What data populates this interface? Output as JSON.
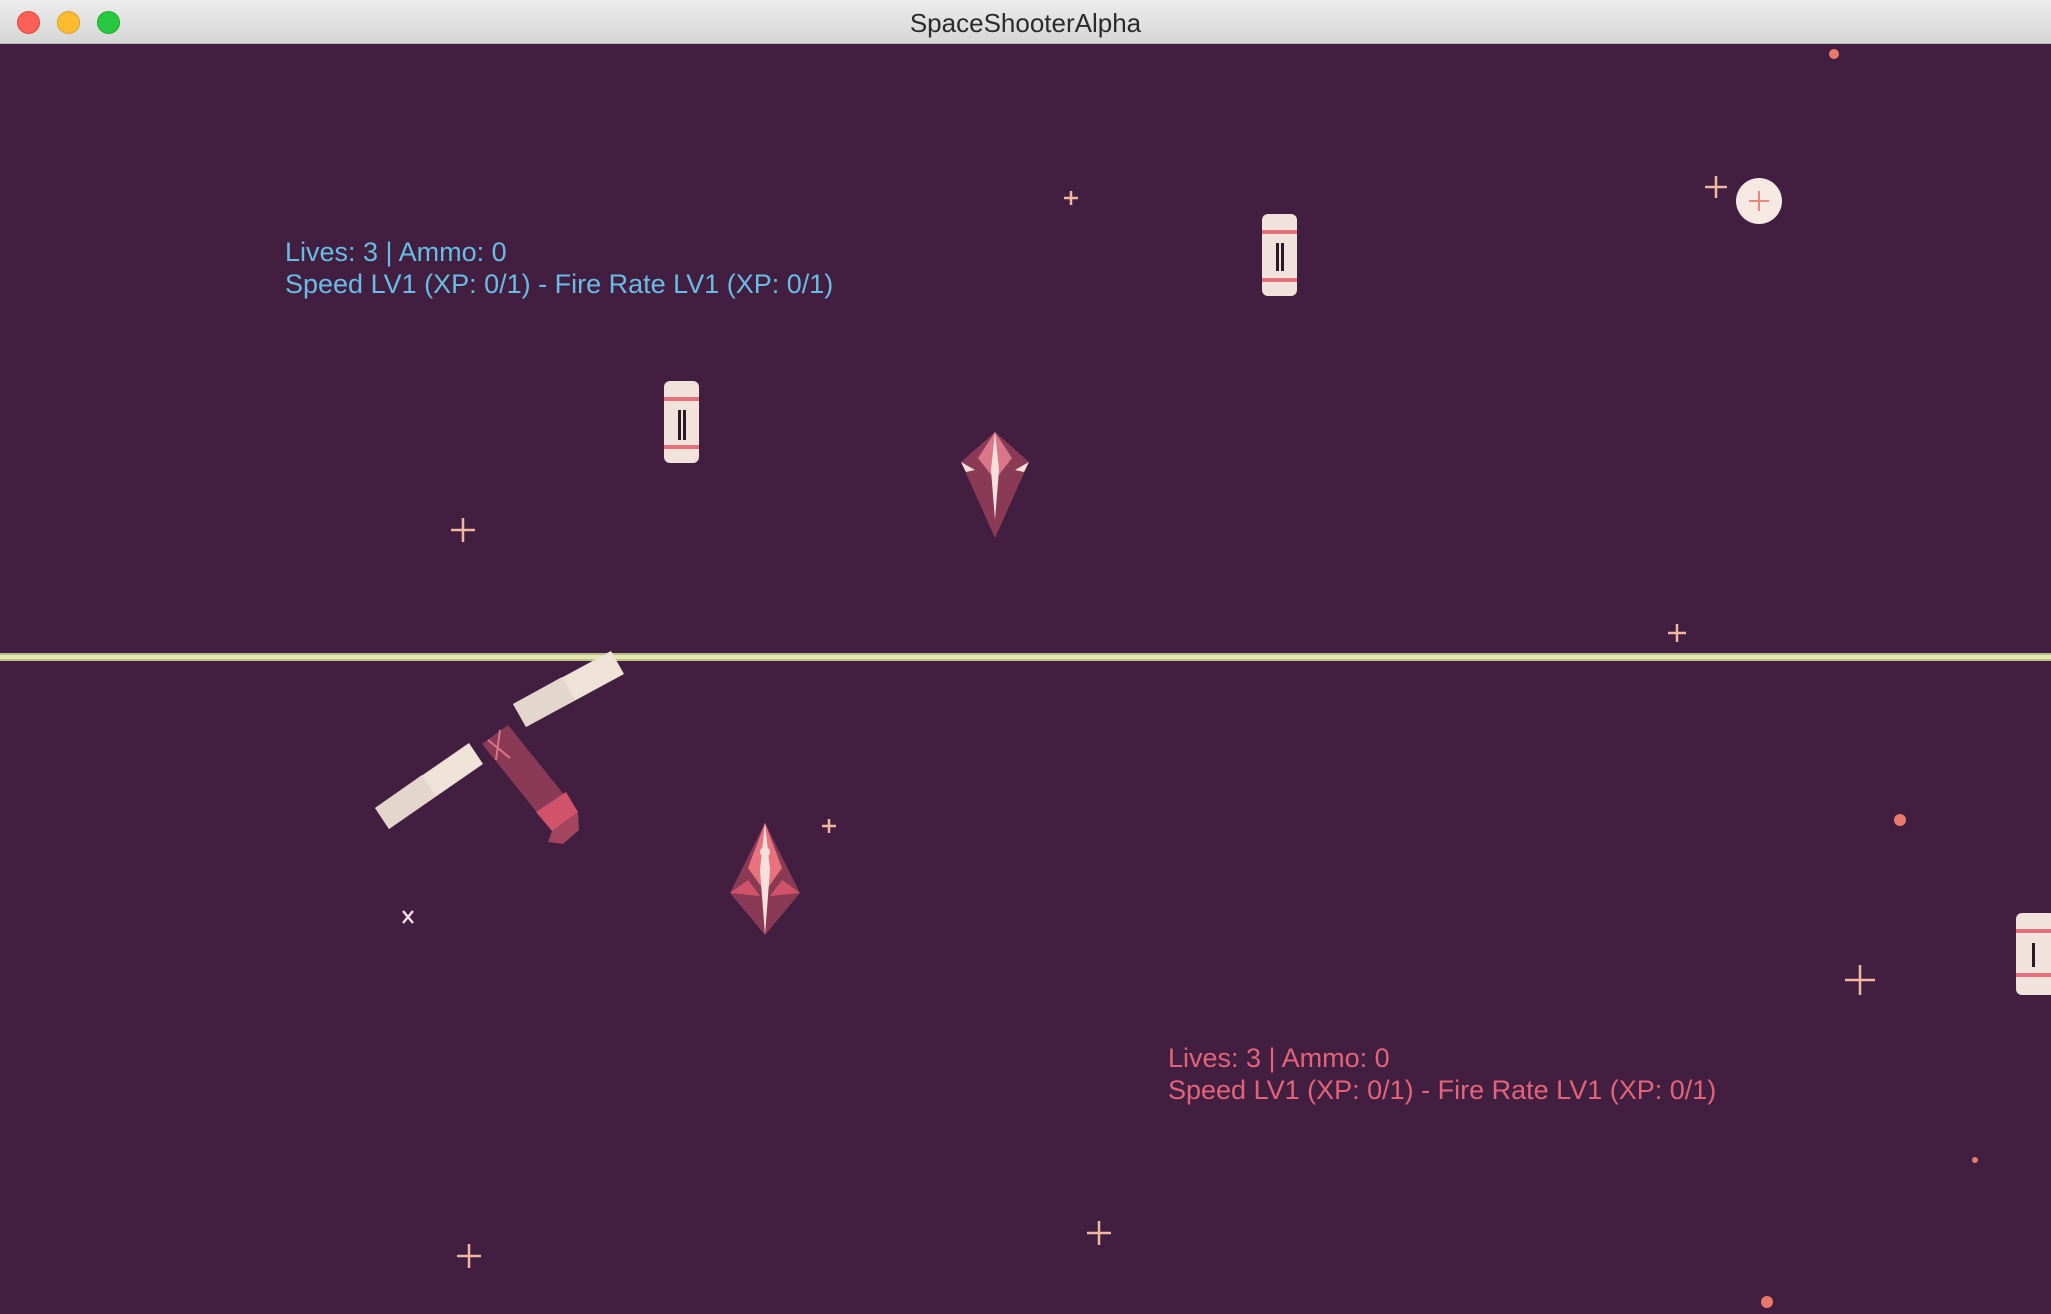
{
  "window": {
    "title": "SpaceShooterAlpha",
    "buttons": [
      "close",
      "minimize",
      "maximize"
    ]
  },
  "colors": {
    "background": "#421f41",
    "divider": "#e4e8b0",
    "player1_hud": "#69bce3",
    "player2_hud": "#e3647a",
    "star": "#f2b7a0",
    "ship_body": "#8a3a55",
    "canister": "#f1e3dc"
  },
  "player1": {
    "status": "Lives: 3 | Ammo: 0",
    "upgrades": "Speed LV1 (XP: 0/1) - Fire Rate LV1 (XP: 0/1)"
  },
  "player2": {
    "status": "Lives: 3 | Ammo: 0",
    "upgrades": "Speed LV1 (XP: 0/1) - Fire Rate LV1 (XP: 0/1)"
  },
  "icons": [
    "player-ship-icon",
    "enemy-ship-icon",
    "ammo-canister-icon",
    "satellite-icon",
    "star-icon",
    "health-pickup-icon"
  ]
}
